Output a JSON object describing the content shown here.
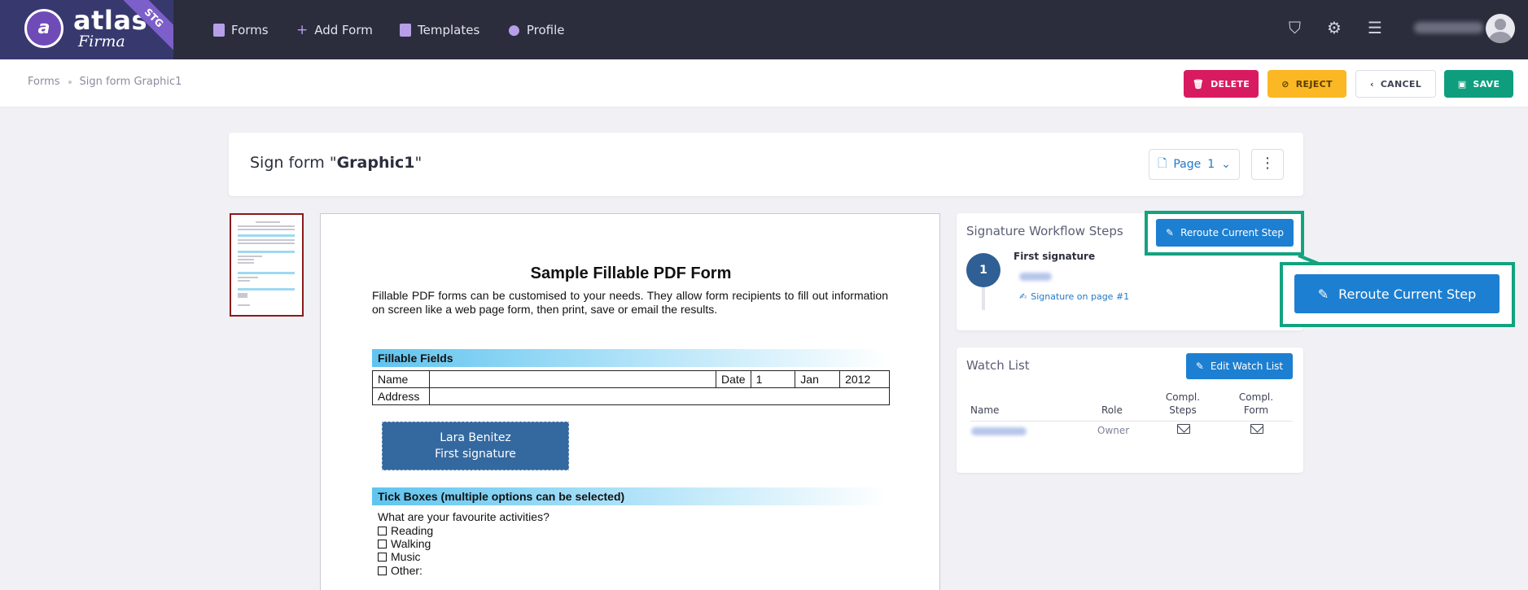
{
  "brand": {
    "name": "atlas",
    "sub": "Firma",
    "env": "STG",
    "accent": "#7d5fc9"
  },
  "nav": [
    {
      "label": "Forms",
      "icon": "documents-icon"
    },
    {
      "label": "Add Form",
      "icon": "plus-icon"
    },
    {
      "label": "Templates",
      "icon": "templates-icon"
    },
    {
      "label": "Profile",
      "icon": "user-icon"
    }
  ],
  "breadcrumb": {
    "root": "Forms",
    "current": "Sign form Graphic1"
  },
  "actions": {
    "delete": "DELETE",
    "reject": "REJECT",
    "cancel": "CANCEL",
    "save": "SAVE"
  },
  "title": {
    "prefix": "Sign form \"",
    "name": "Graphic1",
    "suffix": "\""
  },
  "pager": {
    "label": "Page",
    "value": "1"
  },
  "document": {
    "title": "Sample Fillable PDF Form",
    "intro": "Fillable PDF forms can be customised to your needs. They allow form recipients to fill out information on screen like a web page form, then print, save or email the results.",
    "section1": "Fillable Fields",
    "name_label": "Name",
    "date_label": "Date",
    "date_day": "1",
    "date_month": "Jan",
    "date_year": "2012",
    "address_label": "Address",
    "signature_box": {
      "name": "Lara Benitez",
      "step": "First signature"
    },
    "section2": "Tick Boxes (multiple options can be selected)",
    "question": "What are your favourite activities?",
    "options": [
      "Reading",
      "Walking",
      "Music",
      "Other:"
    ]
  },
  "workflow": {
    "title": "Signature Workflow Steps",
    "reroute": "Reroute Current Step",
    "step_number": "1",
    "step_name": "First signature",
    "step_page": "Signature on page #1"
  },
  "watchlist": {
    "title": "Watch List",
    "edit": "Edit Watch List",
    "col_name": "Name",
    "col_role": "Role",
    "col_steps": "Compl. Steps",
    "col_form": "Compl. Form",
    "role": "Owner"
  }
}
